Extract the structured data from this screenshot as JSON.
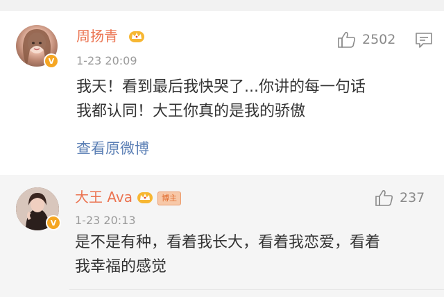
{
  "comments": [
    {
      "username": "周扬青",
      "timestamp": "1-23 20:09",
      "likes": "2502",
      "text_line1": "我天！看到最后我快哭了...你讲的每一句话",
      "text_line2": "我都认同！大王你真的是我的骄傲",
      "view_original": "查看原微博",
      "badges": [
        "crown-icon",
        "verified-icon"
      ]
    },
    {
      "username": "大王 Ava",
      "author_tag": "博主",
      "timestamp": "1-23 20:13",
      "likes": "237",
      "text_line1": "是不是有种，看着我长大，看着我恋爱，看着",
      "text_line2": "我幸福的感觉",
      "badges": [
        "crown-icon",
        "verified-icon"
      ]
    }
  ],
  "colors": {
    "username": "#eb7350",
    "link": "#5b7fb5",
    "text": "#333333",
    "meta": "#9a9a9a",
    "verified": "#f5a623"
  }
}
